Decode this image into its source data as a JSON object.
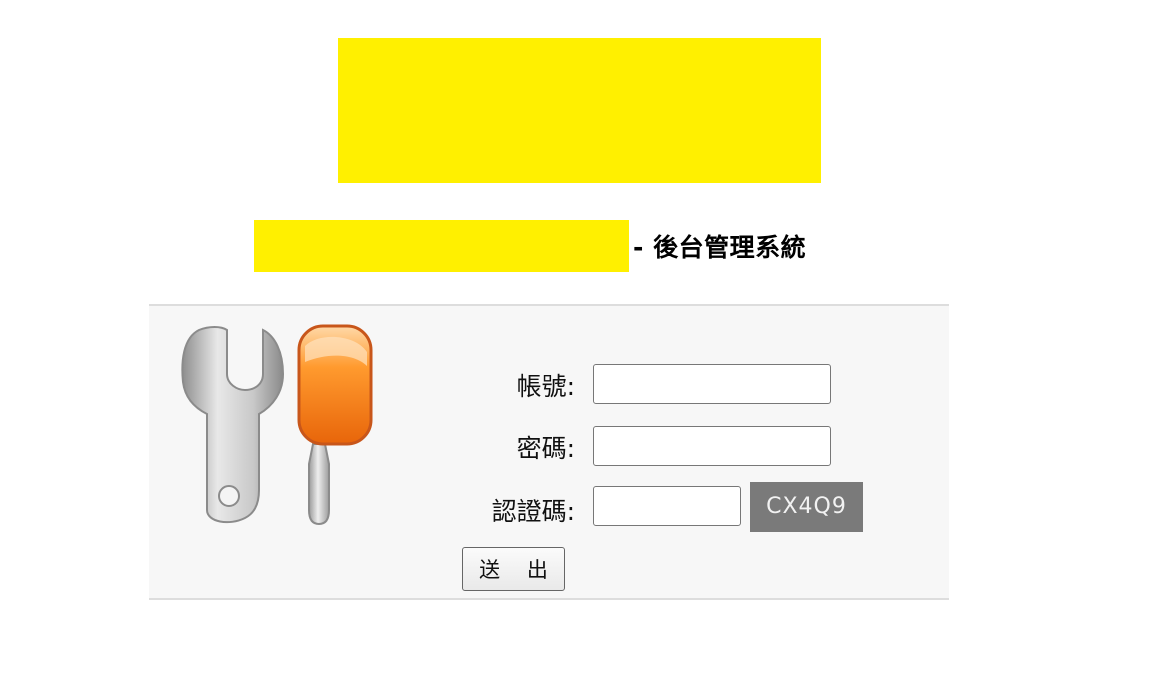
{
  "header": {
    "system_title": "- 後台管理系統"
  },
  "login_form": {
    "account_label": "帳號:",
    "password_label": "密碼:",
    "captcha_label": "認證碼:",
    "account_value": "",
    "password_value": "",
    "captcha_value": "",
    "captcha_code": "CX4Q9",
    "submit_label": "送 出"
  },
  "icons": {
    "tools": "wrench-screwdriver-icon"
  },
  "colors": {
    "redaction": "#fff000",
    "panel_background": "#f7f7f7",
    "captcha_background": "#7a7a7a",
    "screwdriver_handle": "#f58220"
  }
}
